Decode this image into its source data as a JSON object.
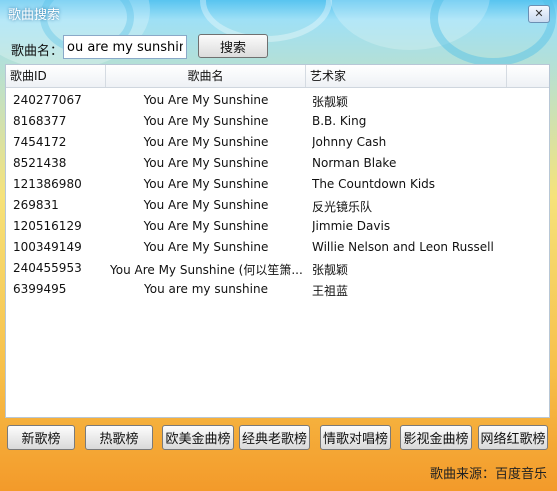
{
  "window": {
    "title": "歌曲搜索",
    "close_glyph": "✕"
  },
  "search": {
    "label": "歌曲名：",
    "value": "ou are my sunshine",
    "button_label": "搜索"
  },
  "columns": [
    "歌曲ID",
    "歌曲名",
    "艺术家"
  ],
  "rows": [
    {
      "id": "240277067",
      "name": "You Are My Sunshine",
      "artist": "张靓颖"
    },
    {
      "id": "8168377",
      "name": "You Are My Sunshine",
      "artist": "B.B. King"
    },
    {
      "id": "7454172",
      "name": "You Are My Sunshine",
      "artist": "Johnny Cash"
    },
    {
      "id": "8521438",
      "name": "You Are My Sunshine",
      "artist": "Norman Blake"
    },
    {
      "id": "121386980",
      "name": "You Are My Sunshine",
      "artist": "The Countdown Kids"
    },
    {
      "id": "269831",
      "name": "You Are My Sunshine",
      "artist": "反光镜乐队"
    },
    {
      "id": "120516129",
      "name": "You Are My Sunshine",
      "artist": "Jimmie Davis"
    },
    {
      "id": "100349149",
      "name": "You Are My Sunshine",
      "artist": "Willie Nelson and Leon Russell"
    },
    {
      "id": "240455953",
      "name": "You Are My Sunshine (何以笙箫...",
      "artist": "张靓颖"
    },
    {
      "id": "6399495",
      "name": "You are my sunshine",
      "artist": "王祖蓝"
    }
  ],
  "chart_buttons": [
    "新歌榜",
    "热歌榜",
    "欧美金曲榜",
    "经典老歌榜",
    "情歌对唱榜",
    "影视金曲榜",
    "网络红歌榜"
  ],
  "source_text": "歌曲来源：百度音乐"
}
